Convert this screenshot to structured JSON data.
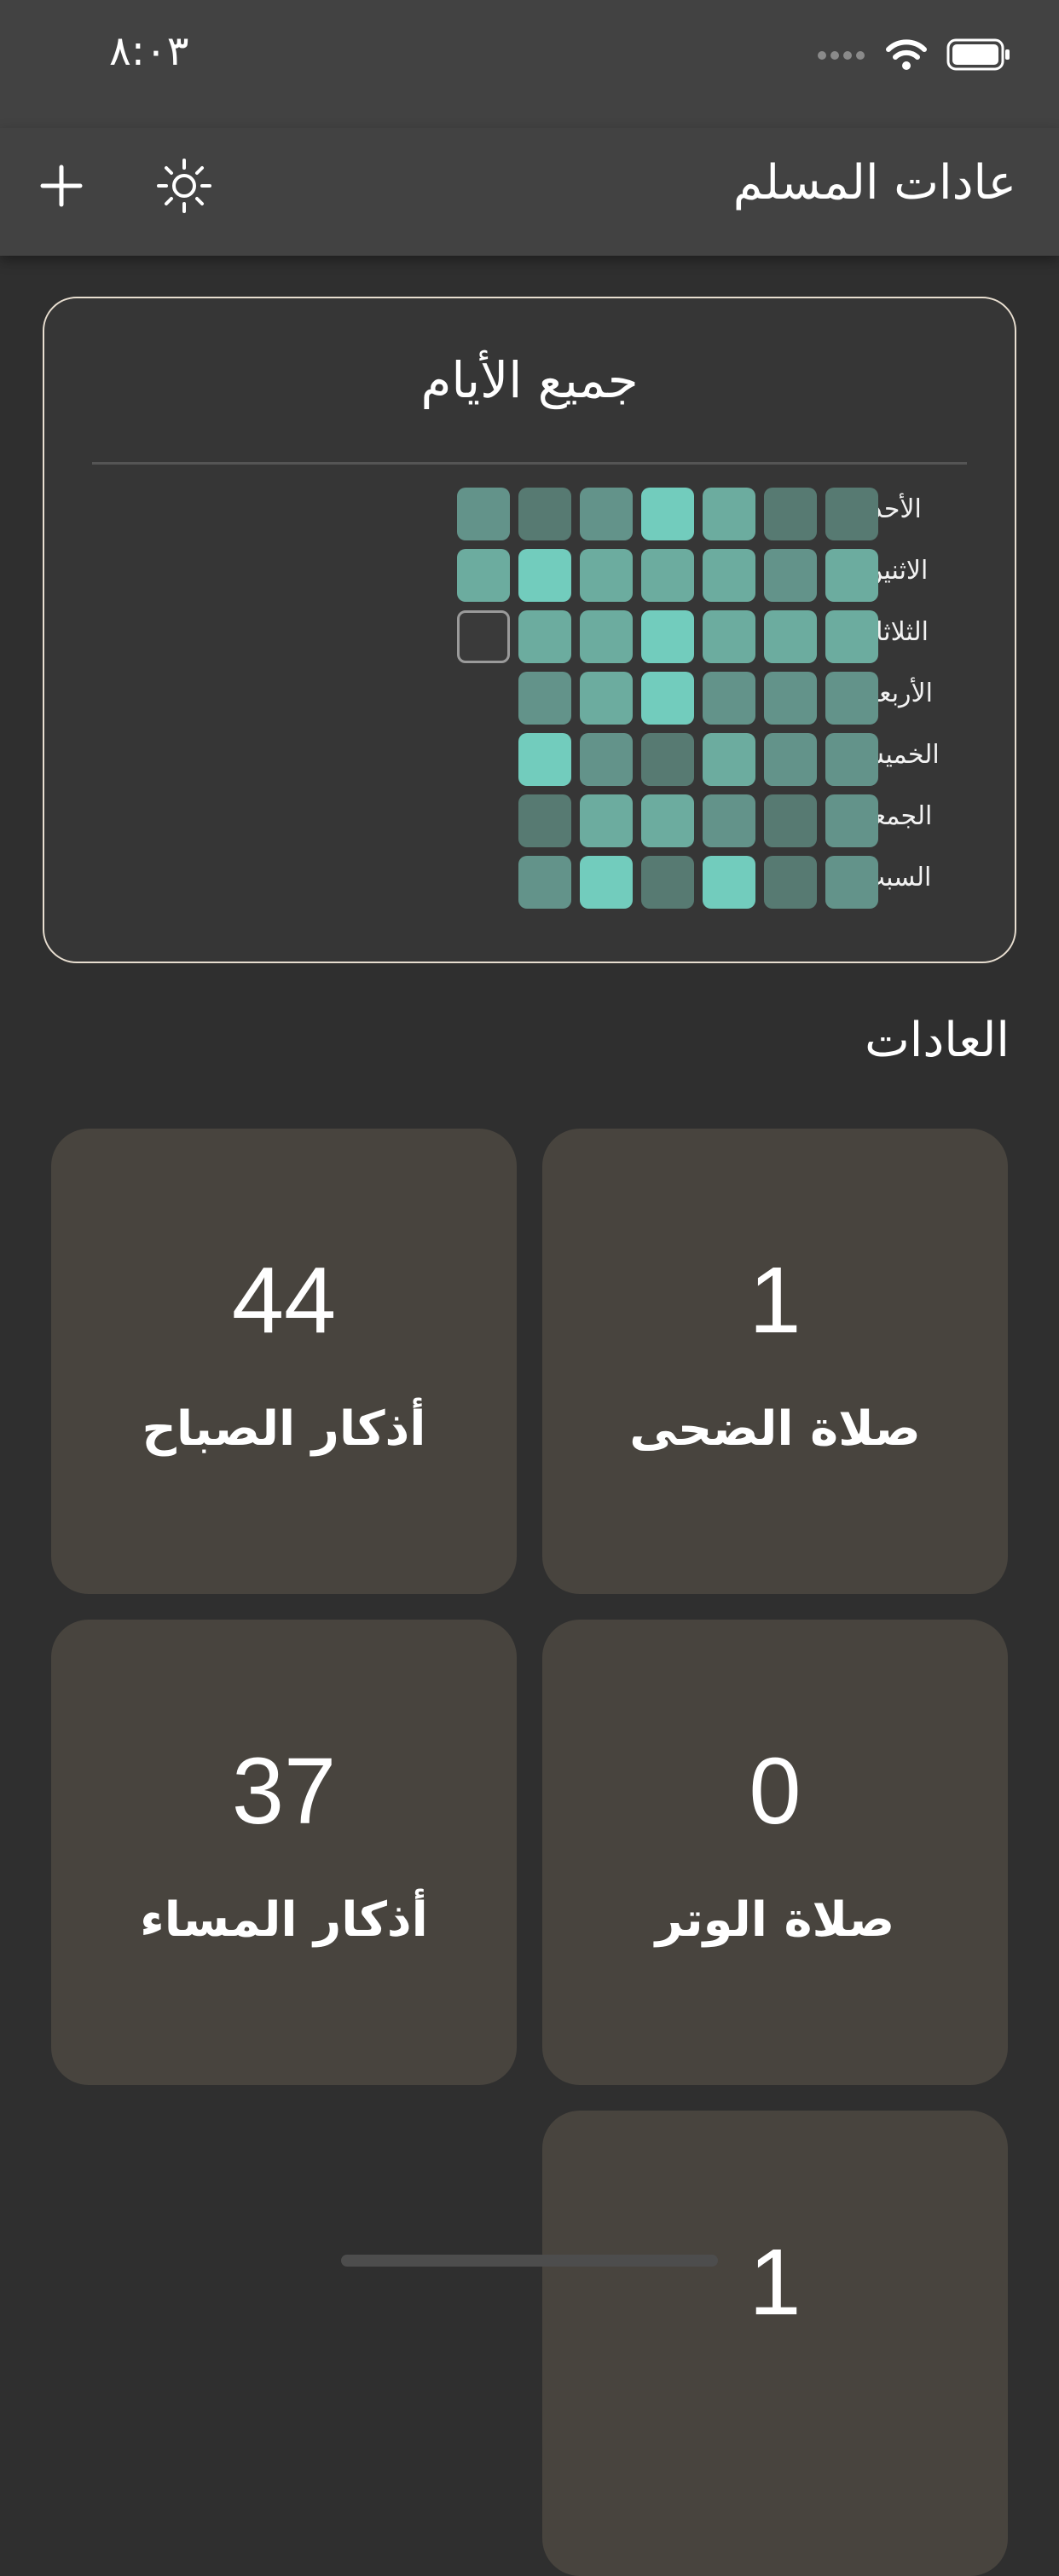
{
  "status_bar": {
    "time": "٨:٠٣",
    "signal_icon": "signal-dots-icon",
    "wifi_icon": "wifi-icon",
    "battery_icon": "battery-icon"
  },
  "nav": {
    "title": "عادات المسلم",
    "add_icon": "plus-icon",
    "theme_icon": "sun-icon"
  },
  "heatmap": {
    "title": "جميع الأيام",
    "days": [
      "الأحد",
      "الاثنين",
      "الثلاثاء",
      "الأربعاء",
      "الخميس",
      "الجمعة",
      "السبت"
    ],
    "colors": {
      "0": "#3a3a3a",
      "1": "#577a72",
      "2": "#63938a",
      "3": "#6cac9f",
      "4": "#72ccbd",
      "border_empty": "#9a9a9a"
    },
    "levels": [
      [
        1,
        1,
        3,
        4,
        2,
        1,
        2
      ],
      [
        3,
        2,
        3,
        3,
        3,
        4,
        3
      ],
      [
        3,
        3,
        3,
        4,
        3,
        3,
        0
      ],
      [
        2,
        2,
        2,
        4,
        3,
        2,
        null
      ],
      [
        2,
        2,
        3,
        1,
        2,
        4,
        null
      ],
      [
        2,
        1,
        2,
        3,
        3,
        1,
        null
      ],
      [
        2,
        1,
        4,
        1,
        4,
        2,
        null
      ]
    ]
  },
  "habits_section": {
    "title": "العادات"
  },
  "habits": [
    {
      "name": "صلاة الضحى",
      "count": "1"
    },
    {
      "name": "أذكار الصباح",
      "count": "44"
    },
    {
      "name": "صلاة الوتر",
      "count": "0"
    },
    {
      "name": "أذكار المساء",
      "count": "37"
    },
    {
      "name": "",
      "count": "1"
    }
  ],
  "theme": {
    "background": "#2f2f2f",
    "bar": "#424242",
    "card": "#48443e",
    "card_border": "#e8ded0"
  }
}
